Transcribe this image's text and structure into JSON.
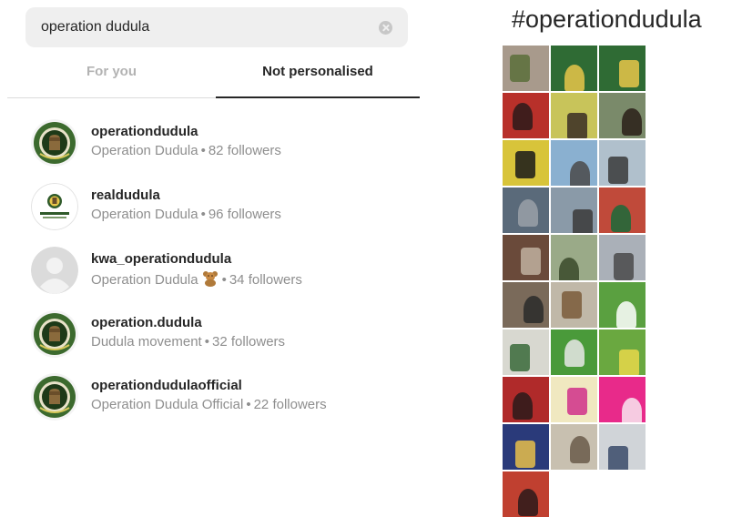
{
  "search": {
    "value": "operation dudula"
  },
  "tabs": [
    {
      "label": "For you"
    },
    {
      "label": "Not personalised"
    }
  ],
  "results": [
    {
      "username": "operationdudula",
      "name": "Operation Dudula",
      "followers": "82 followers",
      "avatar": "logo-green"
    },
    {
      "username": "realdudula",
      "name": "Operation Dudula",
      "followers": "96 followers",
      "avatar": "logo-white"
    },
    {
      "username": "kwa_operationdudula",
      "name": "Operation Dudula",
      "followers": "34 followers",
      "avatar": "default-gray",
      "emoji": "teddy-bear"
    },
    {
      "username": "operation.dudula",
      "name": "Dudula movement",
      "followers": "32 followers",
      "avatar": "logo-green"
    },
    {
      "username": "operationdudulaofficial",
      "name": "Operation Dudula Official",
      "followers": "22 followers",
      "avatar": "logo-green"
    }
  ],
  "separator": "•",
  "hashtag": {
    "title": "#operationdudula"
  },
  "colors": {
    "accent_text": "#262626",
    "muted_text": "#8e8e8e",
    "search_bg": "#efefef",
    "logo_green": "#2f5a2a"
  },
  "grid_thumbs": [
    {
      "bg": "#a89a8c",
      "accent": "#5a6e3a"
    },
    {
      "bg": "#2f6b34",
      "accent": "#e8c64a"
    },
    {
      "bg": "#2f6b34",
      "accent": "#e8c64a"
    },
    {
      "bg": "#b8302a",
      "accent": "#2a1a1a"
    },
    {
      "bg": "#c8c45a",
      "accent": "#3a2e24"
    },
    {
      "bg": "#7a8a6a",
      "accent": "#2a1e18"
    },
    {
      "bg": "#d8c43a",
      "accent": "#1a1a1a"
    },
    {
      "bg": "#8ab0d0",
      "accent": "#4a4a4a"
    },
    {
      "bg": "#b0c0cc",
      "accent": "#3a3a3a"
    },
    {
      "bg": "#5a6a7a",
      "accent": "#9aa0a8"
    },
    {
      "bg": "#8a9aa8",
      "accent": "#3a3a3a"
    },
    {
      "bg": "#c04a3a",
      "accent": "#1a6a3a"
    },
    {
      "bg": "#6a4a3a",
      "accent": "#c0b0a0"
    },
    {
      "bg": "#9aaa88",
      "accent": "#3a4a2a"
    },
    {
      "bg": "#aab0b8",
      "accent": "#4a4a4a"
    },
    {
      "bg": "#7a6a5a",
      "accent": "#2a2a2a"
    },
    {
      "bg": "#c0b8a8",
      "accent": "#7a5a3a"
    },
    {
      "bg": "#5aa040",
      "accent": "#ffffff"
    },
    {
      "bg": "#d8d8d0",
      "accent": "#3a6a3a"
    },
    {
      "bg": "#4a9a3a",
      "accent": "#e8e8e8"
    },
    {
      "bg": "#6aa840",
      "accent": "#e8d84a"
    },
    {
      "bg": "#b02a2a",
      "accent": "#2a1a1a"
    },
    {
      "bg": "#f0e8c0",
      "accent": "#d0308a"
    },
    {
      "bg": "#e82a8a",
      "accent": "#f8e8f0"
    },
    {
      "bg": "#2a3a7a",
      "accent": "#e8c04a"
    },
    {
      "bg": "#c8c0b0",
      "accent": "#6a5a4a"
    },
    {
      "bg": "#d0d4d8",
      "accent": "#3a4a6a"
    },
    {
      "bg": "#c04030",
      "accent": "#2a1a1a"
    }
  ]
}
